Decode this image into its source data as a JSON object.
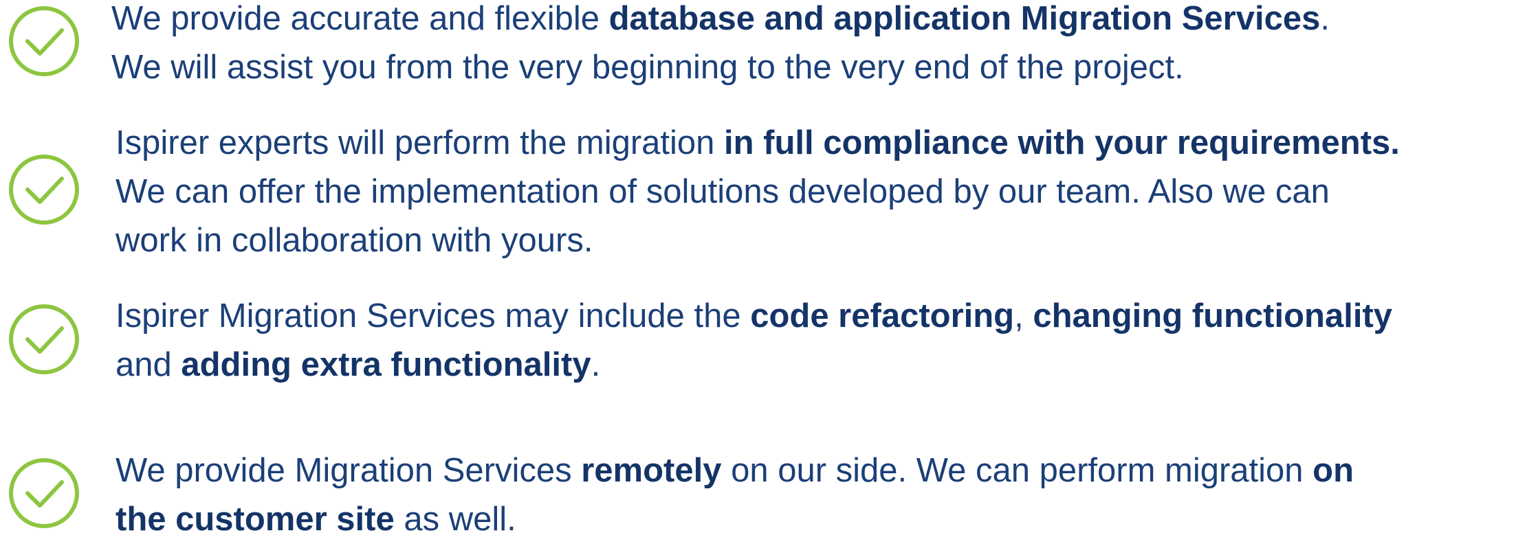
{
  "colors": {
    "text": "#1b3f78",
    "bold_text": "#143468",
    "check": "#8cc63f",
    "background": "#ffffff"
  },
  "icon": "check-circle-icon",
  "items": [
    {
      "lines": [
        [
          {
            "t": "We provide accurate and flexible ",
            "b": false
          },
          {
            "t": "database and application Migration Services",
            "b": true
          },
          {
            "t": ".",
            "b": false
          }
        ],
        [
          {
            "t": "We will assist you from the very beginning to the very end of the project.",
            "b": false
          }
        ]
      ]
    },
    {
      "lines": [
        [
          {
            "t": "Ispirer experts will perform the migration ",
            "b": false
          },
          {
            "t": "in full compliance with your requirements.",
            "b": true
          }
        ],
        [
          {
            "t": "We can offer the implementation of solutions developed by our team. Also we can",
            "b": false
          }
        ],
        [
          {
            "t": "work in collaboration with yours.",
            "b": false
          }
        ]
      ]
    },
    {
      "lines": [
        [
          {
            "t": "Ispirer Migration Services may include the ",
            "b": false
          },
          {
            "t": "code refactoring",
            "b": true
          },
          {
            "t": ", ",
            "b": false
          },
          {
            "t": "changing functionality",
            "b": true
          }
        ],
        [
          {
            "t": "and ",
            "b": false
          },
          {
            "t": "adding extra functionality",
            "b": true
          },
          {
            "t": ".",
            "b": false
          }
        ]
      ]
    },
    {
      "lines": [
        [
          {
            "t": "We provide Migration Services ",
            "b": false
          },
          {
            "t": "remotely",
            "b": true
          },
          {
            "t": " on our side. We can perform migration ",
            "b": false
          },
          {
            "t": "on",
            "b": true
          }
        ],
        [
          {
            "t": "the customer site",
            "b": true
          },
          {
            "t": " as well.",
            "b": false
          }
        ]
      ]
    }
  ]
}
